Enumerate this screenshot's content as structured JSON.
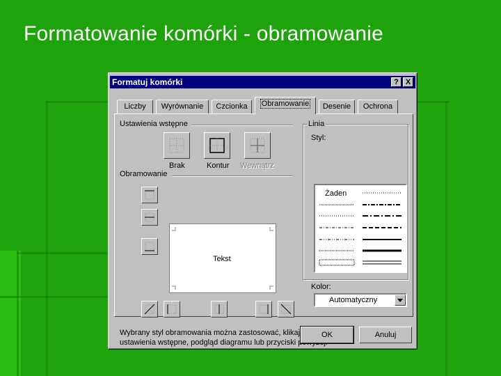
{
  "slide": {
    "title": "Formatowanie komórki - obramowanie"
  },
  "dialog": {
    "title": "Formatuj komórki",
    "help_label": "?",
    "close_label": "X",
    "tabs": [
      {
        "label": "Liczby"
      },
      {
        "label": "Wyrównanie"
      },
      {
        "label": "Czcionka"
      },
      {
        "label": "Obramowanie",
        "active": true
      },
      {
        "label": "Desenie"
      },
      {
        "label": "Ochrona"
      }
    ],
    "presets": {
      "label": "Ustawienia wstępne",
      "none": "Brak",
      "outline": "Kontur",
      "inside": "Wewnątrz"
    },
    "border_section_label": "Obramowanie",
    "preview_text": "Tekst",
    "line": {
      "group_label": "Linia",
      "style_label": "Styl:",
      "none_style": "Żaden",
      "color_label": "Kolor:",
      "color_value": "Automatyczny"
    },
    "hint": [
      "Wybrany styl obramowania można zastosować, klikając",
      "ustawienia wstępne, podgląd diagramu lub przyciski powyżej."
    ],
    "ok_label": "OK",
    "cancel_label": "Anuluj"
  },
  "colors": {
    "background": "#1fa30c",
    "title_bar": "#000080",
    "dialog_face": "#c0c0c0"
  }
}
